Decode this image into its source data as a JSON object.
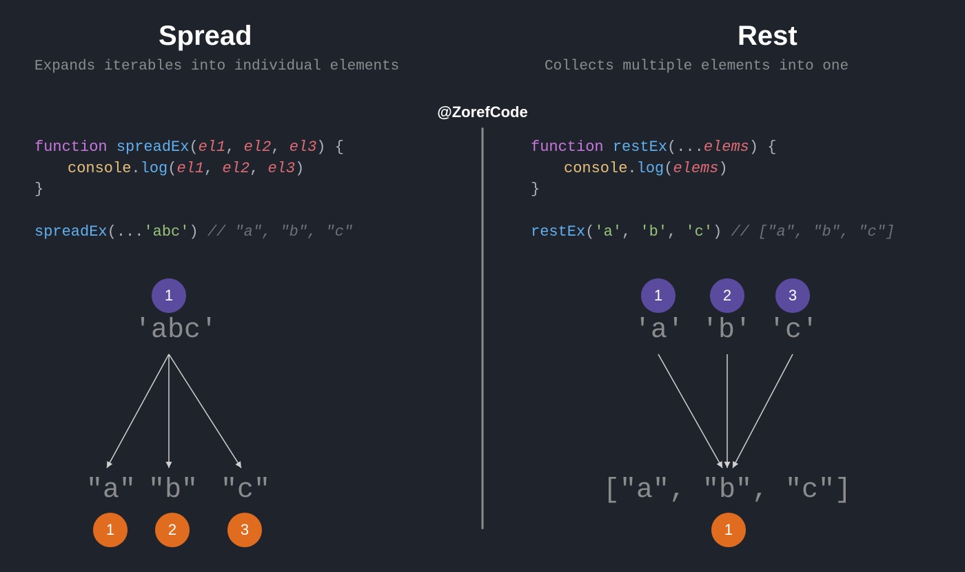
{
  "handle": "@ZorefCode",
  "colors": {
    "purple": "#5a4b9e",
    "orange": "#e06c1f",
    "bg": "#1f232c"
  },
  "spread": {
    "title": "Spread",
    "subtitle": "Expands iterables into individual elements",
    "code": {
      "keyword": "function",
      "name": "spreadEx",
      "params": [
        "el1",
        "el2",
        "el3"
      ],
      "body_obj": "console",
      "body_method": "log",
      "body_args": [
        "el1",
        "el2",
        "el3"
      ],
      "call_name": "spreadEx",
      "call_op": "...",
      "call_arg": "'abc'",
      "comment": "// \"a\", \"b\", \"c\""
    },
    "viz": {
      "top_badge": "1",
      "top_text": "'abc'",
      "outputs": [
        "\"a\"",
        "\"b\"",
        "\"c\""
      ],
      "bottom_badges": [
        "1",
        "2",
        "3"
      ]
    }
  },
  "rest": {
    "title": "Rest",
    "subtitle": "Collects multiple elements into one",
    "code": {
      "keyword": "function",
      "name": "restEx",
      "params_op": "...",
      "params": [
        "elems"
      ],
      "body_obj": "console",
      "body_method": "log",
      "body_args": [
        "elems"
      ],
      "call_name": "restEx",
      "call_args": [
        "'a'",
        "'b'",
        "'c'"
      ],
      "comment": "// [\"a\", \"b\", \"c\"]"
    },
    "viz": {
      "top_badges": [
        "1",
        "2",
        "3"
      ],
      "top_texts": [
        "'a'",
        "'b'",
        "'c'"
      ],
      "output": "[\"a\", \"b\", \"c\"]",
      "bottom_badge": "1"
    }
  }
}
